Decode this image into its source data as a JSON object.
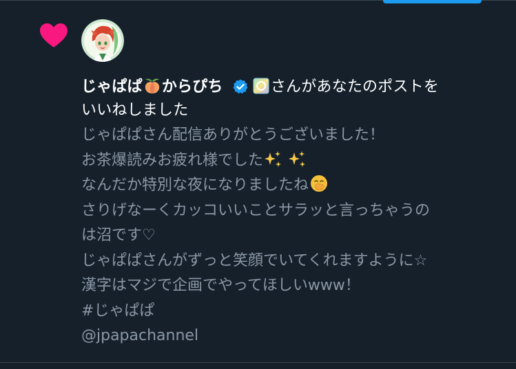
{
  "notification": {
    "icon": "heart-icon",
    "icon_color": "#f91880",
    "user_name_part1": "じゃぱぱ",
    "user_name_part2": "からぴち",
    "name_emoji_1": "peach-emoji",
    "verified_badge": "verified-badge-icon",
    "name_emoji_2": "gradient-badge-emoji",
    "action_text": "さんがあなたのポストを",
    "action_text_2": "いいねしました"
  },
  "post": {
    "line_1": "じゃぱぱさん配信ありがとうございました！",
    "line_2": "お茶爆読みお疲れ様でした",
    "line_2_emoji": "sparkles-emoji",
    "line_3": "なんだか特別な夜になりましたね",
    "line_3_emoji": "hand-over-mouth-emoji",
    "line_4": "さりげなーくカッコいいことサラッと言っちゃうの",
    "line_5": "は沼です♡",
    "line_6": "じゃぱぱさんがずっと笑顔でいてくれますように☆",
    "line_7": "漢字はマジで企画でやってほしいwww！",
    "line_8": "#じゃぱぱ",
    "line_9": "@jpapachannel"
  },
  "colors": {
    "background": "#15202b",
    "primary_text": "#ffffff",
    "secondary_text": "#8b98a5",
    "accent": "#1d9bf0",
    "like": "#f91880"
  }
}
